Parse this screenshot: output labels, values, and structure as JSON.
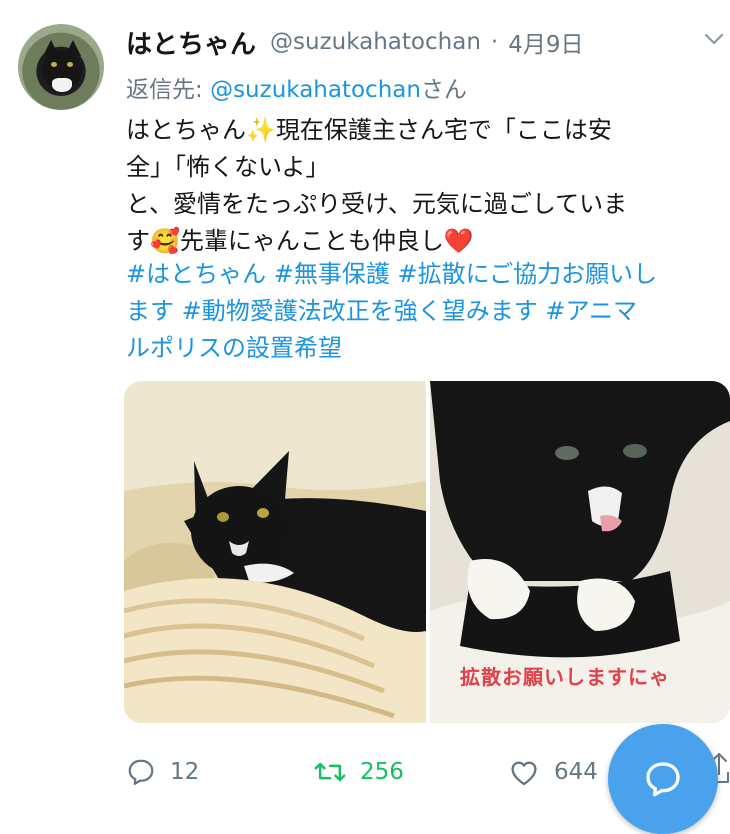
{
  "tweet": {
    "display_name": "はとちゃん",
    "handle": "@suzukahatochan",
    "separator": "·",
    "date": "4月9日",
    "reply_prefix": "返信先: ",
    "reply_mention": "@suzukahatochan",
    "reply_suffix": "さん",
    "body_lines": [
      "はとちゃん✨現在保護主さん宅で「ここは安",
      "全」「怖くないよ」",
      "と、愛情をたっぷり受け、元気に過ごしていま",
      "す🥰先輩にゃんことも仲良し❤️"
    ],
    "hashtag_lines": [
      "#はとちゃん #無事保護 #拡散にご協力お願いし",
      "ます #動物愛護法改正を強く望みます #アニマ",
      "ルポリスの設置希望"
    ],
    "image_caption": "拡散お願いしますにゃ"
  },
  "actions": {
    "reply_count": "12",
    "retweet_count": "256",
    "like_count": "644"
  },
  "icons": {
    "more": "chevron-down-icon",
    "reply": "reply-icon",
    "retweet": "retweet-icon",
    "like": "heart-icon",
    "share": "share-icon",
    "compose": "compose-reply-icon"
  },
  "colors": {
    "text": "#14171a",
    "muted": "#657786",
    "link": "#1b95e0",
    "retweet": "#17bf63",
    "fab": "#4aa1ec"
  }
}
